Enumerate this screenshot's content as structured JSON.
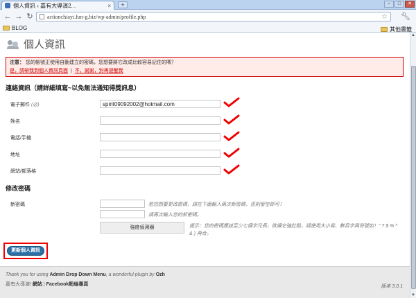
{
  "browser": {
    "tab_title": "個人資訊 ‹ 嘉有大導演2...",
    "tab_close": "×",
    "new_tab": "+",
    "url": "actionchiayi.fun-g.biz/wp-admin/profile.php",
    "bookmark_left": "BLOG",
    "bookmark_right": "其他書籤"
  },
  "header": {
    "title": "個人資訊"
  },
  "notice": {
    "label": "注意：",
    "message": "您的帳號正使用自動建立的密碼，您想要將它改成比較容易記住的嗎？",
    "link_yes": "是，請帶我到個人資訊頁面",
    "link_separator": "|",
    "link_no": "不，謝謝，別再提醒我"
  },
  "contact": {
    "title": "連絡資訊（請詳細填寫~以免無法通知得獎訊息）",
    "email_label": "電子郵件",
    "email_required": "(必)",
    "email_value": "spirit09092002@hotmail.com",
    "name_label": "姓名",
    "phone_label": "電話/手機",
    "address_label": "地址",
    "website_label": "網站/部落格"
  },
  "password": {
    "title": "修改密碼",
    "new_label": "新密碼",
    "hint1": "若您想要更改密碼，請在下面輸入兩次新密碼，否則留空即可！",
    "hint2": "請再次輸入您的新密碼。",
    "strength_label": "強度偵測器",
    "strength_hint": "提示：您的密碼應該至少七個字元長，欲讓它強壯點，請使用大小寫、數目字與符號如！\" ? $ % ^ & ) 再合。"
  },
  "update_button": "更新個人資訊",
  "footer": {
    "thanks_prefix": "Thank you for using",
    "plugin_name": "Admin Drop Down Menu",
    "thanks_mid": ", a wonderful plugin by",
    "author": "Ozh",
    "site_prefix": "嘉有大導演!",
    "site_link1": "網站",
    "site_sep": "|",
    "site_link2": "Facebook粉絲專頁",
    "version": "版本 3.0.1"
  },
  "colors": {
    "accent_red": "#e00000",
    "button_blue": "#2a6fa6",
    "notice_bg": "#ffebe8"
  }
}
